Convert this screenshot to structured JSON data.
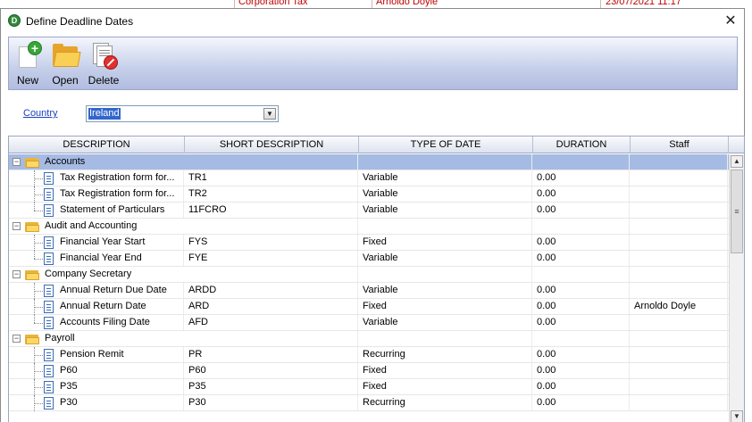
{
  "background_row": {
    "col1": "Corporation Tax",
    "col2": "Arnoldo Doyle",
    "col3": "23/07/2021 11:17"
  },
  "window": {
    "title": "Define Deadline Dates",
    "close_glyph": "✕"
  },
  "toolbar": {
    "new_label": "New",
    "open_label": "Open",
    "delete_label": "Delete"
  },
  "country": {
    "label": "Country",
    "value": "Ireland",
    "dropdown_glyph": "▼"
  },
  "grid": {
    "columns": {
      "description": "DESCRIPTION",
      "short_description": "SHORT DESCRIPTION",
      "type_of_date": "TYPE OF DATE",
      "duration": "DURATION",
      "staff": "Staff"
    },
    "rows": [
      {
        "kind": "group",
        "desc": "Accounts",
        "short": "",
        "type": "",
        "duration": "",
        "staff": "",
        "selected": true
      },
      {
        "kind": "item",
        "desc": "Tax Registration form for...",
        "short": "TR1",
        "type": "Variable",
        "duration": "0.00",
        "staff": ""
      },
      {
        "kind": "item",
        "desc": "Tax Registration form for...",
        "short": "TR2",
        "type": "Variable",
        "duration": "0.00",
        "staff": ""
      },
      {
        "kind": "item",
        "desc": "Statement of Particulars",
        "short": "11FCRO",
        "type": "Variable",
        "duration": "0.00",
        "staff": "",
        "last": true
      },
      {
        "kind": "group",
        "desc": "Audit and Accounting",
        "short": "",
        "type": "",
        "duration": "",
        "staff": ""
      },
      {
        "kind": "item",
        "desc": "Financial Year Start",
        "short": "FYS",
        "type": "Fixed",
        "duration": "0.00",
        "staff": ""
      },
      {
        "kind": "item",
        "desc": "Financial Year End",
        "short": "FYE",
        "type": "Variable",
        "duration": "0.00",
        "staff": "",
        "last": true
      },
      {
        "kind": "group",
        "desc": "Company Secretary",
        "short": "",
        "type": "",
        "duration": "",
        "staff": ""
      },
      {
        "kind": "item",
        "desc": "Annual Return Due Date",
        "short": "ARDD",
        "type": "Variable",
        "duration": "0.00",
        "staff": ""
      },
      {
        "kind": "item",
        "desc": "Annual Return Date",
        "short": "ARD",
        "type": "Fixed",
        "duration": "0.00",
        "staff": "Arnoldo Doyle"
      },
      {
        "kind": "item",
        "desc": "Accounts Filing Date",
        "short": "AFD",
        "type": "Variable",
        "duration": "0.00",
        "staff": "",
        "last": true
      },
      {
        "kind": "group",
        "desc": "Payroll",
        "short": "",
        "type": "",
        "duration": "",
        "staff": ""
      },
      {
        "kind": "item",
        "desc": "Pension Remit",
        "short": "PR",
        "type": "Recurring",
        "duration": "0.00",
        "staff": ""
      },
      {
        "kind": "item",
        "desc": "P60",
        "short": "P60",
        "type": "Fixed",
        "duration": "0.00",
        "staff": ""
      },
      {
        "kind": "item",
        "desc": "P35",
        "short": "P35",
        "type": "Fixed",
        "duration": "0.00",
        "staff": ""
      },
      {
        "kind": "item",
        "desc": "P30",
        "short": "P30",
        "type": "Recurring",
        "duration": "0.00",
        "staff": ""
      }
    ]
  },
  "scrollbar": {
    "up_glyph": "▲",
    "down_glyph": "▼",
    "thumb_glyph": "≡"
  },
  "colors": {
    "selection": "#a6bbe4",
    "link": "#1a3fbf",
    "toolbar_gradient_bottom": "#b2bde0"
  },
  "icons": {
    "title": "app-logo-icon",
    "new": "new-document-plus-icon",
    "open": "open-folder-icon",
    "delete": "delete-document-icon",
    "group": "folder-icon",
    "item": "document-icon"
  }
}
